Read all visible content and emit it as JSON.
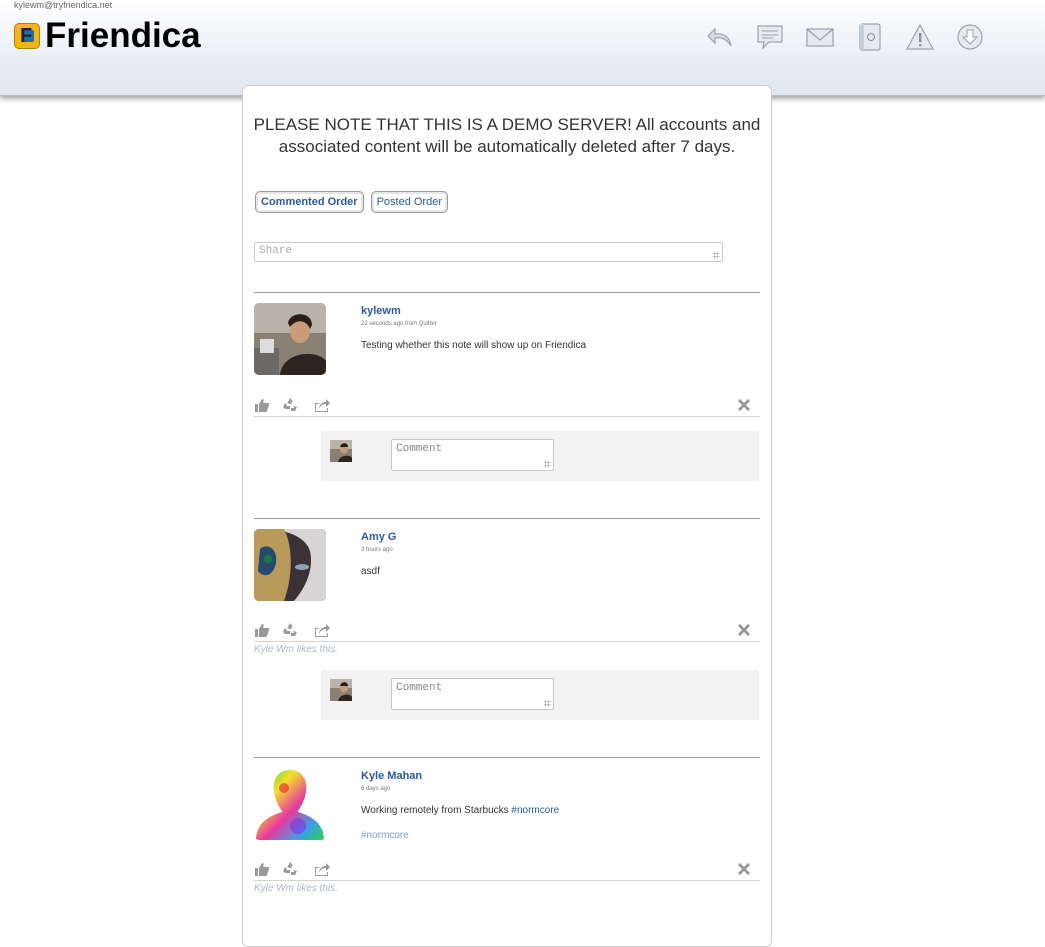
{
  "header": {
    "account": "kylewm@tryfriendica.net",
    "app_name": "Friendica",
    "nav_icons": [
      "back-icon",
      "comment-bubble-icon",
      "mail-icon",
      "contact-book-icon",
      "warning-icon",
      "download-icon"
    ]
  },
  "notice": "PLEASE NOTE THAT THIS IS A DEMO SERVER! All accounts and associated content will be automatically deleted after 7 days.",
  "order_tabs": [
    {
      "label": "Commented Order",
      "active": true
    },
    {
      "label": "Posted Order",
      "active": false
    }
  ],
  "share_placeholder": "Share",
  "comment_placeholder": "Comment",
  "posts": [
    {
      "author": "kylewm",
      "ago": "22 seconds ago from Quitter",
      "body": "Testing whether this note will show up on Friendica",
      "likes": ""
    },
    {
      "author": "Amy G",
      "ago": "3 hours ago",
      "body": "asdf",
      "likes": "Kyle Wm likes this."
    },
    {
      "author": "Kyle Mahan",
      "ago": "6 days ago",
      "body_prefix": "Working remotely from Starbucks ",
      "body_tag": "#normcore",
      "hashtag": "#normcore",
      "likes": "Kyle Wm likes this."
    }
  ],
  "colors": {
    "link": "#2a5a9c",
    "likes": "#aab8c6",
    "logo_orange": "#f6b31a",
    "logo_blue": "#1a6fa8"
  }
}
